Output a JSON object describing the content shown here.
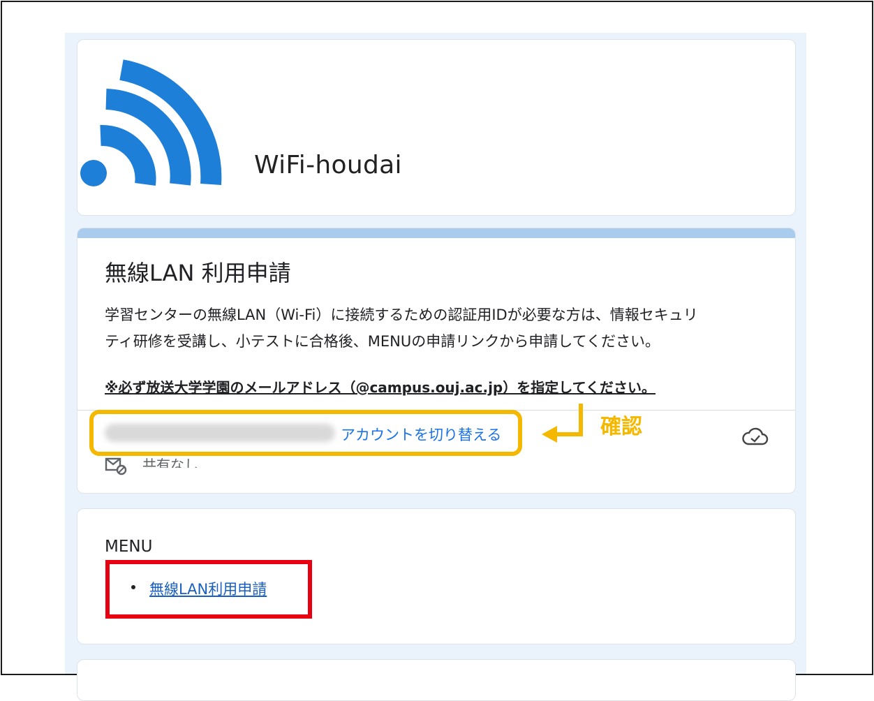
{
  "app": {
    "title": "WiFi-houdai",
    "logo_icon": "wifi-icon",
    "logo_color": "#1e7fd8"
  },
  "form": {
    "title": "無線LAN 利用申請",
    "description_lines": [
      "学習センターの無線LAN（Wi-Fi）に接続するための認証用IDが必要な方は、情報セキュリ",
      "ティ研修を受講し、小テストに合格後、MENUの申請リンクから申請してください。"
    ],
    "notice": "※必ず放送大学学園のメールアドレス（@campus.ouj.ac.jp）を指定してください。",
    "account": {
      "switch_link": "アカウントを切り替える",
      "sharing_status": "共有なし",
      "cloud_icon": "cloud-check-icon",
      "share_icon": "no-share-icon"
    },
    "accent_color": "#a8cbee"
  },
  "annotation": {
    "confirm_label": "確認",
    "color": "#f5b800"
  },
  "menu": {
    "heading": "MENU",
    "items": [
      {
        "label": "無線LAN利用申請"
      }
    ],
    "highlight_color": "#e60012"
  }
}
